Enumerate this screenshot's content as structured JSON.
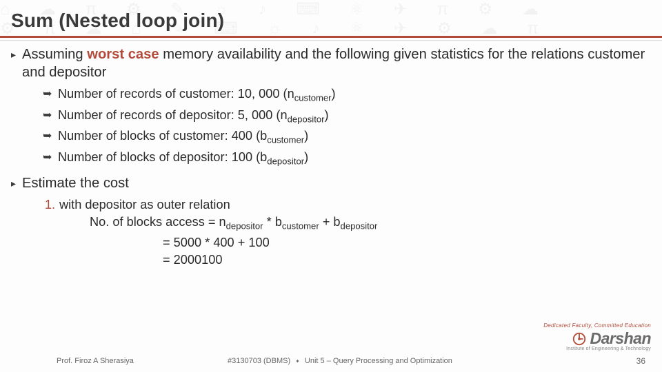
{
  "title": "Sum (Nested loop join)",
  "bullet1_pre": "Assuming ",
  "bullet1_hl": "worst case",
  "bullet1_post": "  memory availability and the following given statistics for the relations customer and depositor",
  "sub1_pre": "Number of records of customer: 10, 000 (n",
  "sub1_sub": "customer",
  "sub1_post": ")",
  "sub2_pre": "Number of records of depositor: 5, 000 (n",
  "sub2_sub": "depositor",
  "sub2_post": ")",
  "sub3_pre": "Number of blocks of customer: 400 (b",
  "sub3_sub": "customer",
  "sub3_post": ")",
  "sub4_pre": "Number of blocks of depositor: 100 (b",
  "sub4_sub": "depositor",
  "sub4_post": ")",
  "bullet2": "Estimate the cost",
  "ord_num": "1.",
  "ord_line1": "with depositor as outer relation",
  "eq_l_pre": "No. of blocks access = n",
  "eq_l_s1": "depositor",
  "eq_l_mid1": " * b",
  "eq_l_s2": "customer",
  "eq_l_mid2": " + b",
  "eq_l_s3": "depositor",
  "eq_line2": "= 5000 * 400 + 100",
  "eq_line3": "= 2000100",
  "footer": {
    "prof": "Prof. Firoz A Sherasiya",
    "course": "#3130703 (DBMS) ",
    "unit": " Unit 5 – Query Processing and Optimization",
    "page": "36"
  },
  "logo": {
    "tagline": "Dedicated Faculty, Committed Education",
    "name": "Darshan",
    "sub": "Institute of Engineering & Technology"
  },
  "glyphs": {
    "tri": "▸",
    "arrow": "➥",
    "diamond": "✦"
  }
}
